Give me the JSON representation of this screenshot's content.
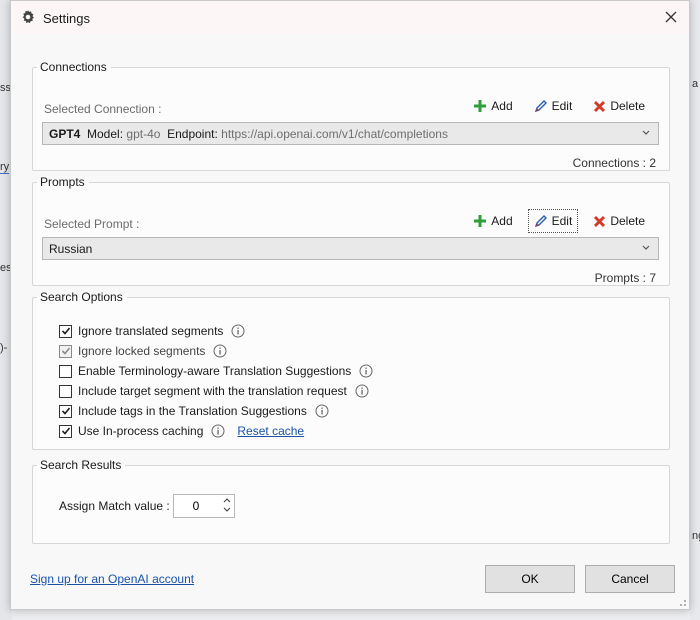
{
  "dialog": {
    "title": "Settings"
  },
  "background": {
    "frag1": "ss",
    "frag2": "ry",
    "frag3": "es",
    "frag4": ")-",
    "frag5": "a",
    "frag6": "ng"
  },
  "connections": {
    "legend": "Connections",
    "selected_label": "Selected Connection :",
    "add": "Add",
    "edit": "Edit",
    "delete": "Delete",
    "combo": {
      "name": "GPT4",
      "model_label": "Model:",
      "model_value": "gpt-4o",
      "endpoint_label": "Endpoint:",
      "endpoint_value": "https://api.openai.com/v1/chat/completions"
    },
    "count": "Connections : 2"
  },
  "prompts": {
    "legend": "Prompts",
    "selected_label": "Selected Prompt :",
    "add": "Add",
    "edit": "Edit",
    "delete": "Delete",
    "combo_value": "Russian",
    "count": "Prompts : 7"
  },
  "search_options": {
    "legend": "Search Options",
    "items": [
      {
        "label": "Ignore translated segments",
        "checked": true,
        "enabled": true
      },
      {
        "label": "Ignore locked segments",
        "checked": true,
        "enabled": false
      },
      {
        "label": "Enable Terminology-aware Translation Suggestions",
        "checked": false,
        "enabled": true
      },
      {
        "label": "Include target segment with the translation request",
        "checked": false,
        "enabled": true
      },
      {
        "label": "Include tags in the Translation Suggestions",
        "checked": true,
        "enabled": true
      },
      {
        "label": "Use In-process caching",
        "checked": true,
        "enabled": true
      }
    ],
    "reset_cache": "Reset cache"
  },
  "search_results": {
    "legend": "Search Results",
    "assign_label": "Assign Match value :",
    "assign_value": "0"
  },
  "footer": {
    "signup_link": "Sign up for an OpenAI account",
    "ok": "OK",
    "cancel": "Cancel"
  },
  "colors": {
    "add_green": "#2e9e3a",
    "delete_red": "#d23a2a",
    "edit_blue": "#2a5db0",
    "link": "#1a52a8"
  }
}
